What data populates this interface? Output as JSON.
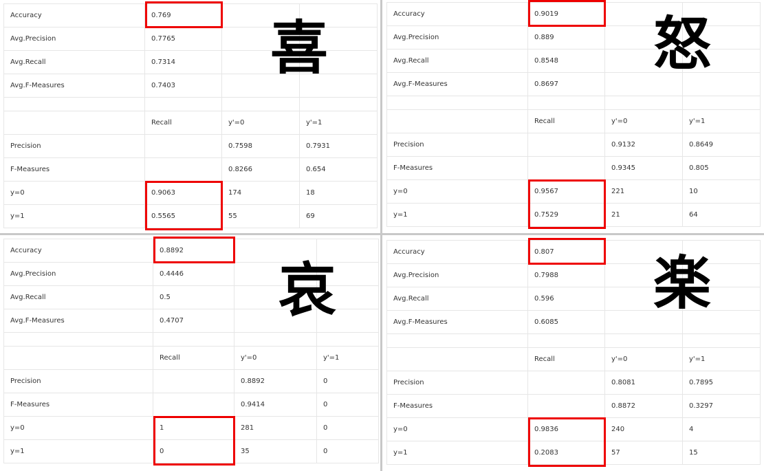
{
  "accent_color": "#ee0000",
  "panels": [
    {
      "emotion": "喜",
      "accuracy": "0.769",
      "avg_precision": "0.7765",
      "avg_recall": "0.7314",
      "avg_f": "0.7403",
      "precision": [
        "0.7598",
        "0.7931"
      ],
      "f_measures": [
        "0.8266",
        "0.654"
      ],
      "recall": [
        "0.9063",
        "0.5565"
      ],
      "confusion": [
        [
          "174",
          "18"
        ],
        [
          "55",
          "69"
        ]
      ]
    },
    {
      "emotion": "怒",
      "accuracy": "0.9019",
      "avg_precision": "0.889",
      "avg_recall": "0.8548",
      "avg_f": "0.8697",
      "precision": [
        "0.9132",
        "0.8649"
      ],
      "f_measures": [
        "0.9345",
        "0.805"
      ],
      "recall": [
        "0.9567",
        "0.7529"
      ],
      "confusion": [
        [
          "221",
          "10"
        ],
        [
          "21",
          "64"
        ]
      ]
    },
    {
      "emotion": "哀",
      "accuracy": "0.8892",
      "avg_precision": "0.4446",
      "avg_recall": "0.5",
      "avg_f": "0.4707",
      "precision": [
        "0.8892",
        "0"
      ],
      "f_measures": [
        "0.9414",
        "0"
      ],
      "recall": [
        "1",
        "0"
      ],
      "confusion": [
        [
          "281",
          "0"
        ],
        [
          "35",
          "0"
        ]
      ]
    },
    {
      "emotion": "楽",
      "accuracy": "0.807",
      "avg_precision": "0.7988",
      "avg_recall": "0.596",
      "avg_f": "0.6085",
      "precision": [
        "0.8081",
        "0.7895"
      ],
      "f_measures": [
        "0.8872",
        "0.3297"
      ],
      "recall": [
        "0.9836",
        "0.2083"
      ],
      "confusion": [
        [
          "240",
          "4"
        ],
        [
          "57",
          "15"
        ]
      ]
    }
  ],
  "labels": {
    "accuracy": "Accuracy",
    "avg_precision": "Avg.Precision",
    "avg_recall": "Avg.Recall",
    "avg_f": "Avg.F-Measures",
    "recall": "Recall",
    "pred0": "y'=0",
    "pred1": "y'=1",
    "precision": "Precision",
    "f_measures": "F-Measures",
    "true0": "y=0",
    "true1": "y=1"
  }
}
